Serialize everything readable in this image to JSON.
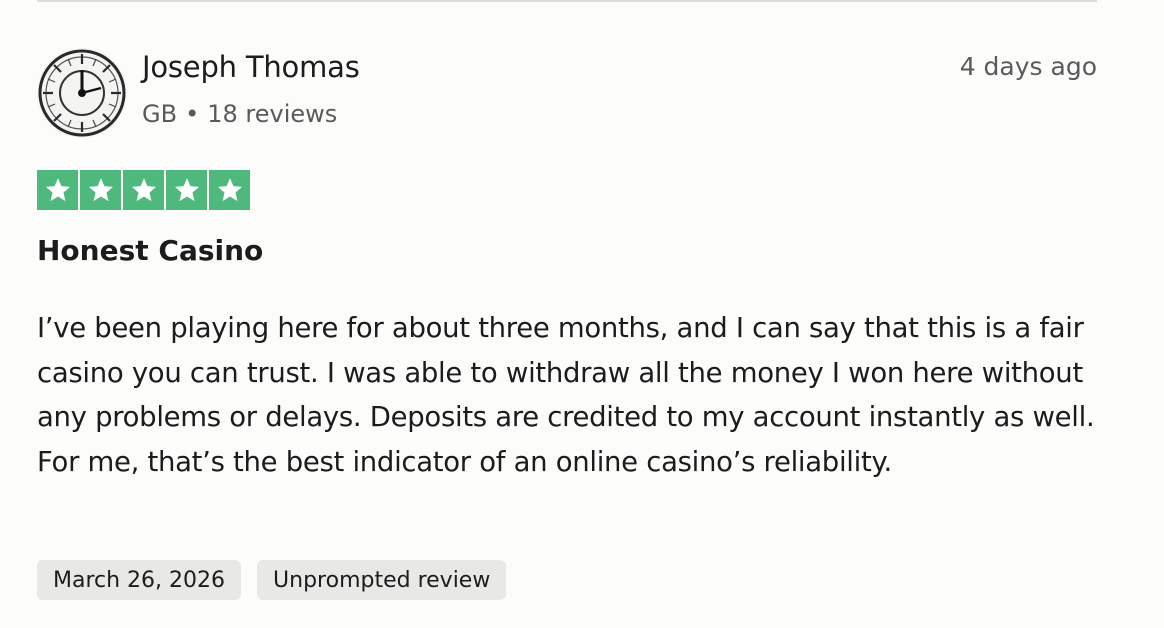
{
  "consumer": {
    "name": "Joseph Thomas",
    "country": "GB",
    "separator": "•",
    "reviews_count": "18 reviews",
    "avatar_icon": "wall-clock-icon"
  },
  "review": {
    "relative_date": "4 days ago",
    "rating": 5,
    "rating_color": "#4fb97d",
    "title": "Honest Casino",
    "body": "I’ve been playing here for about three months, and I can say that this is a fair casino you can trust. I was able to withdraw all the money I won here without any problems or delays. Deposits are credited to my account instantly as well. For me, that’s the best indicator of an online casino’s reliability.",
    "date_of_experience": "March 26, 2026",
    "tag": "Unprompted review"
  }
}
